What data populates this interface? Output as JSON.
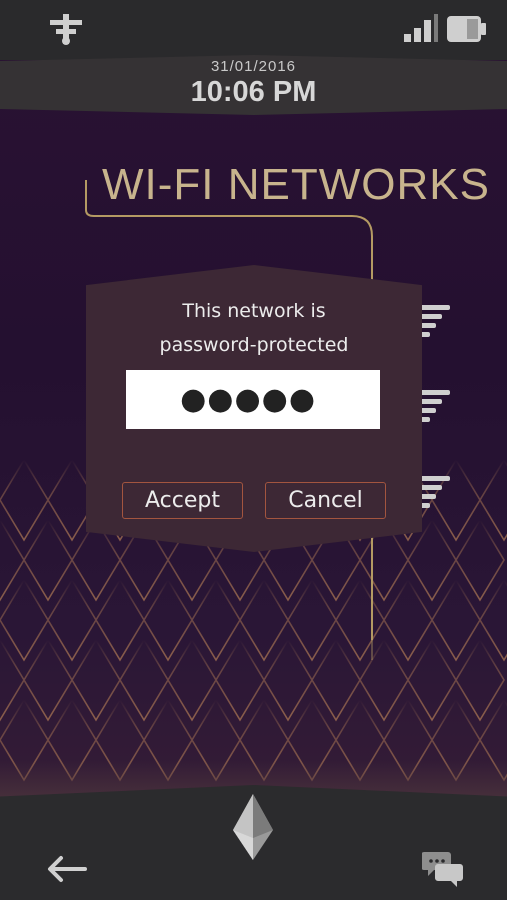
{
  "status_bar": {
    "signal_icon": "signal-bars-icon",
    "battery_icon": "battery-icon",
    "network_icon": "network-tower-icon"
  },
  "header": {
    "date": "31/01/2016",
    "time": "10:06 PM"
  },
  "page": {
    "title": "WI-FI NETWORKS"
  },
  "dialog": {
    "message_line1": "This network is",
    "message_line2": "password-protected",
    "password_value": "●●●●●",
    "accept_label": "Accept",
    "cancel_label": "Cancel"
  },
  "bottom_bar": {
    "back_icon": "back-arrow-icon",
    "home_icon": "crystal-home-icon",
    "chat_icon": "chat-bubbles-icon"
  },
  "colors": {
    "accent_gold": "#c8b48d",
    "button_border": "#a3553f",
    "dialog_bg": "#3d2835"
  }
}
